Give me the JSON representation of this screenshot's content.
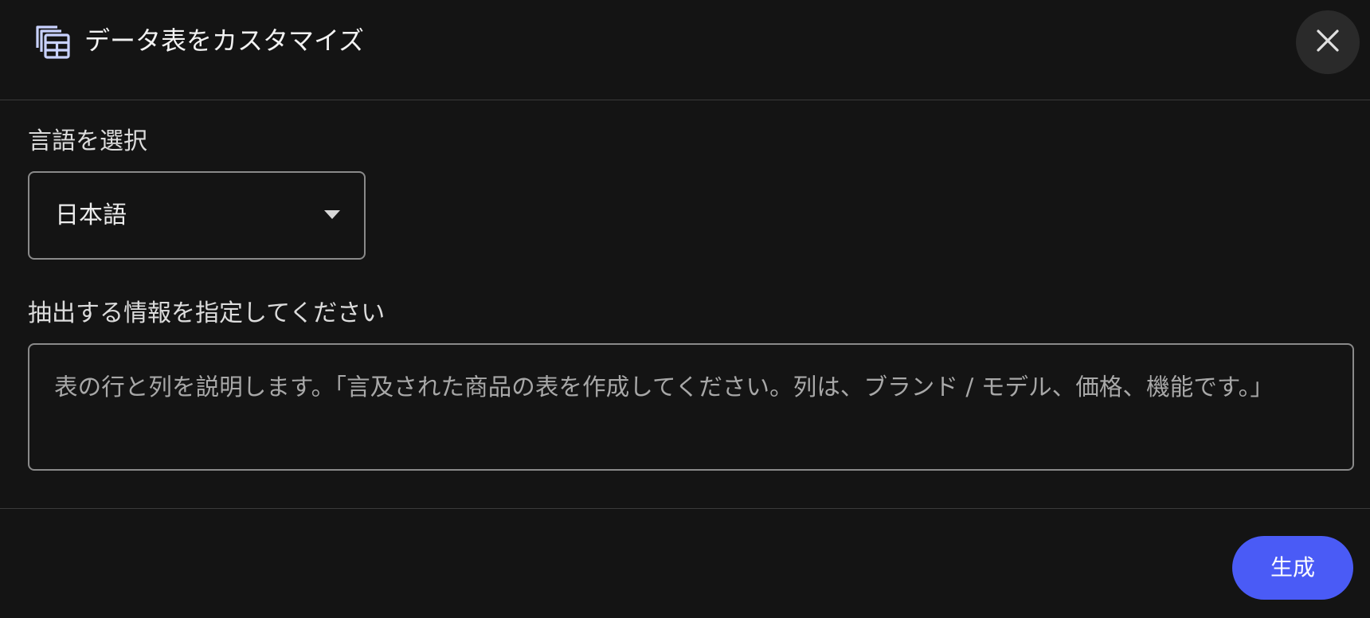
{
  "header": {
    "title": "データ表をカスタマイズ",
    "icon": "table-icon",
    "close_icon": "close-icon"
  },
  "language": {
    "label": "言語を選択",
    "selected": "日本語"
  },
  "extract": {
    "label": "抽出する情報を指定してください",
    "placeholder": "表の行と列を説明します。「言及された商品の表を作成してください。列は、ブランド / モデル、価格、機能です。」"
  },
  "footer": {
    "generate_label": "生成"
  },
  "colors": {
    "background": "#141414",
    "accent": "#4a5bf6",
    "border": "#8a8a8a"
  }
}
